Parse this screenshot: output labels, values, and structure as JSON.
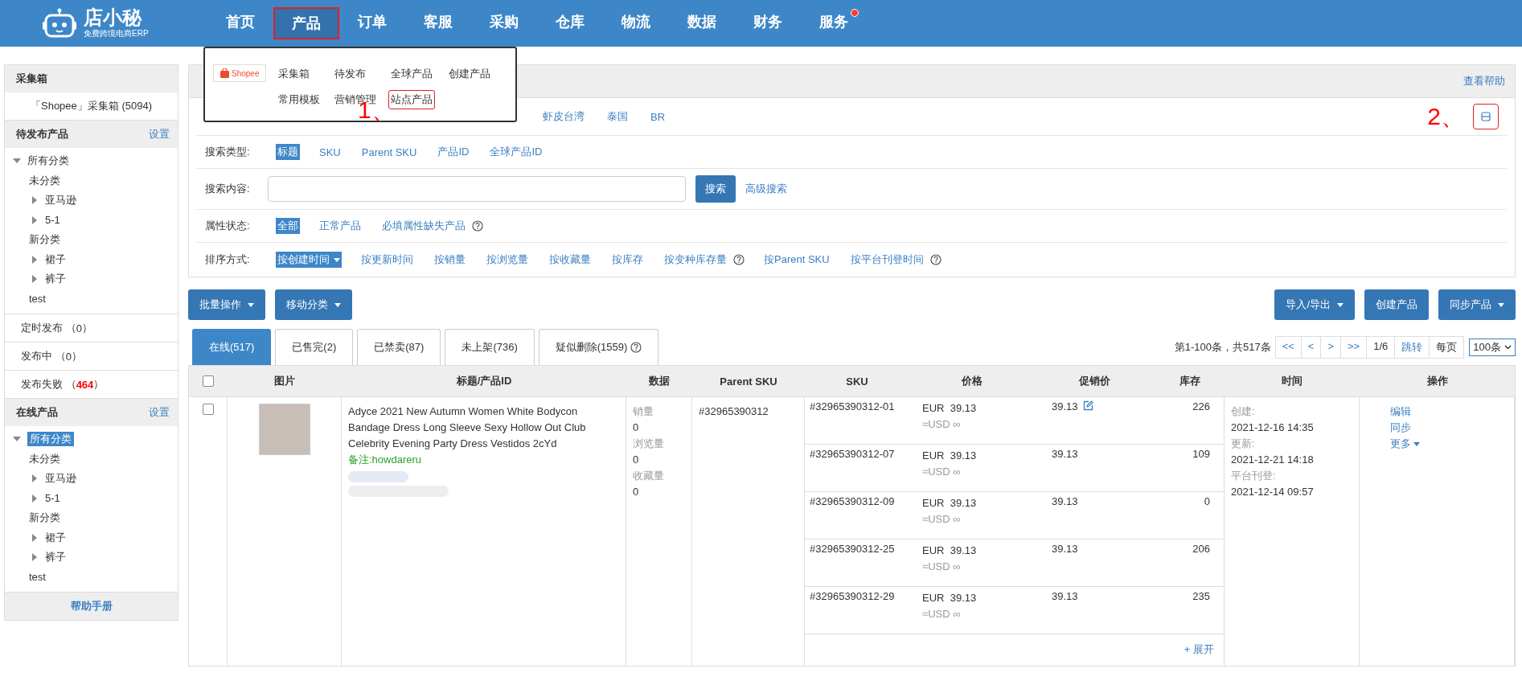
{
  "header": {
    "logo": {
      "name": "店小秘",
      "tagline": "免费跨境电商ERP"
    },
    "nav": [
      {
        "label": "首页",
        "selected": false,
        "marked": false,
        "badge": false
      },
      {
        "label": "产品",
        "selected": true,
        "marked": true,
        "badge": false
      },
      {
        "label": "订单",
        "selected": false,
        "marked": false,
        "badge": false
      },
      {
        "label": "客服",
        "selected": false,
        "marked": false,
        "badge": false
      },
      {
        "label": "采购",
        "selected": false,
        "marked": false,
        "badge": false
      },
      {
        "label": "仓库",
        "selected": false,
        "marked": false,
        "badge": false
      },
      {
        "label": "物流",
        "selected": false,
        "marked": false,
        "badge": false
      },
      {
        "label": "数据",
        "selected": false,
        "marked": false,
        "badge": false
      },
      {
        "label": "财务",
        "selected": false,
        "marked": false,
        "badge": false
      },
      {
        "label": "服务",
        "selected": false,
        "marked": false,
        "badge": true
      }
    ]
  },
  "dropdown": {
    "platform": "Shopee",
    "annotation": "1、",
    "items": [
      {
        "label": "采集箱",
        "marked": false
      },
      {
        "label": "待发布",
        "marked": false
      },
      {
        "label": "全球产品",
        "marked": false
      },
      {
        "label": "创建产品",
        "marked": false
      },
      {
        "label": "常用模板",
        "marked": false
      },
      {
        "label": "营销管理",
        "marked": false
      },
      {
        "label": "站点产品",
        "marked": true
      }
    ]
  },
  "sidebar": {
    "sections": [
      {
        "kind": "list",
        "title": "采集箱",
        "items": [
          {
            "label": "「Shopee」采集箱 (5094)"
          }
        ]
      },
      {
        "kind": "tree",
        "title": "待发布产品",
        "action": "设置",
        "tree": [
          {
            "label": "所有分类",
            "expanded": true,
            "selected": false,
            "children": [
              {
                "label": "未分类",
                "selected": false,
                "children": [
                  {
                    "label": "亚马逊",
                    "expanded": false,
                    "selected": false
                  },
                  {
                    "label": "5-1",
                    "expanded": false,
                    "selected": false
                  }
                ]
              },
              {
                "label": "新分类",
                "selected": false,
                "children": [
                  {
                    "label": "裙子",
                    "expanded": false,
                    "selected": false
                  },
                  {
                    "label": "裤子",
                    "expanded": false,
                    "selected": false
                  }
                ]
              },
              {
                "label": "test",
                "selected": false
              }
            ]
          }
        ]
      },
      {
        "kind": "status",
        "items": [
          {
            "label": "定时发布 （**0**）",
            "alert": false
          },
          {
            "label": "发布中 （**0**）",
            "alert": false
          },
          {
            "label": "发布失败 （**464**）",
            "alert": true
          }
        ]
      },
      {
        "kind": "tree",
        "title": "在线产品",
        "action": "设置",
        "tree": [
          {
            "label": "所有分类",
            "expanded": true,
            "selected": true,
            "children": [
              {
                "label": "未分类",
                "selected": false,
                "children": [
                  {
                    "label": "亚马逊",
                    "expanded": false,
                    "selected": false
                  },
                  {
                    "label": "5-1",
                    "expanded": false,
                    "selected": false
                  }
                ]
              },
              {
                "label": "新分类",
                "selected": false,
                "children": [
                  {
                    "label": "裙子",
                    "expanded": false,
                    "selected": false
                  },
                  {
                    "label": "裤子",
                    "expanded": false,
                    "selected": false
                  }
                ]
              },
              {
                "label": "test",
                "selected": false
              }
            ]
          }
        ]
      }
    ],
    "footer": "帮助手册"
  },
  "filters": {
    "help_link": "查看帮助",
    "sites": [
      "虾皮台湾",
      "泰国",
      "BR"
    ],
    "annotation": "2、",
    "toggle_marked": true,
    "rows": [
      {
        "kind": "options",
        "label": "搜索类型:",
        "options": [
          {
            "label": "标题",
            "selected": true,
            "help": false
          },
          {
            "label": "SKU",
            "selected": false,
            "help": false
          },
          {
            "label": "Parent SKU",
            "selected": false,
            "help": false
          },
          {
            "label": "产品ID",
            "selected": false,
            "help": false
          },
          {
            "label": "全球产品ID",
            "selected": false,
            "help": false
          }
        ]
      },
      {
        "kind": "search",
        "label": "搜索内容:",
        "button": "搜索",
        "link": "高级搜索"
      },
      {
        "kind": "options",
        "label": "属性状态:",
        "options": [
          {
            "label": "全部",
            "selected": true,
            "help": false
          },
          {
            "label": "正常产品",
            "selected": false,
            "help": false
          },
          {
            "label": "必填属性缺失产品",
            "selected": false,
            "help": true
          }
        ]
      },
      {
        "kind": "sort",
        "label": "排序方式:",
        "options": [
          {
            "label": "按创建时间",
            "selected": true,
            "help": false
          },
          {
            "label": "按更新时间",
            "selected": false,
            "help": false
          },
          {
            "label": "按销量",
            "selected": false,
            "help": false
          },
          {
            "label": "按浏览量",
            "selected": false,
            "help": false
          },
          {
            "label": "按收藏量",
            "selected": false,
            "help": false
          },
          {
            "label": "按库存",
            "selected": false,
            "help": false
          },
          {
            "label": "按变种库存量",
            "selected": false,
            "help": true
          },
          {
            "label": "按Parent SKU",
            "selected": false,
            "help": false
          },
          {
            "label": "按平台刊登时间",
            "selected": false,
            "help": true
          }
        ]
      }
    ]
  },
  "toolbar": {
    "left": [
      {
        "label": "批量操作",
        "dropdown": true
      },
      {
        "label": "移动分类",
        "dropdown": true
      }
    ],
    "right": [
      {
        "label": "导入/导出",
        "dropdown": true
      },
      {
        "label": "创建产品",
        "dropdown": false
      },
      {
        "label": "同步产品",
        "dropdown": true
      }
    ]
  },
  "tabs": [
    {
      "label": "在线(517)",
      "selected": true,
      "help": false
    },
    {
      "label": "已售完(2)",
      "selected": false,
      "help": false
    },
    {
      "label": "已禁卖(87)",
      "selected": false,
      "help": false
    },
    {
      "label": "未上架(736)",
      "selected": false,
      "help": false
    },
    {
      "label": "疑似删除(1559)",
      "selected": false,
      "help": true
    }
  ],
  "pagination": {
    "summary": "第1-100条，共517条",
    "buttons": [
      "<<",
      "<",
      ">",
      ">>"
    ],
    "page": "1/6",
    "jump": "跳转",
    "per_page_label": "每页",
    "per_page": "100条"
  },
  "table": {
    "select_all": false,
    "columns": [
      "图片",
      "标题/产品ID",
      "数据",
      "Parent SKU",
      "SKU",
      "价格",
      "促销价",
      "库存",
      "时间",
      "操作"
    ],
    "rows": [
      {
        "checked": false,
        "title": "Adyce 2021 New Autumn Women White Bodycon Bandage Dress Long Sleeve Sexy Hollow Out Club Celebrity Evening Party Dress Vestidos 2cYd",
        "remark": "备注:howdareru",
        "data": [
          {
            "label": "销量",
            "value": "0"
          },
          {
            "label": "浏览量",
            "value": "0"
          },
          {
            "label": "收藏量",
            "value": "0"
          }
        ],
        "parent_sku": "#32965390312",
        "variants": [
          {
            "sku": "#32965390312-01",
            "currency": "EUR",
            "price": "39.13",
            "usd": "≈USD ∞",
            "promo": "39.13",
            "editable": true,
            "stock": "226"
          },
          {
            "sku": "#32965390312-07",
            "currency": "EUR",
            "price": "39.13",
            "usd": "≈USD ∞",
            "promo": "39.13",
            "editable": false,
            "stock": "109"
          },
          {
            "sku": "#32965390312-09",
            "currency": "EUR",
            "price": "39.13",
            "usd": "≈USD ∞",
            "promo": "39.13",
            "editable": false,
            "stock": "0"
          },
          {
            "sku": "#32965390312-25",
            "currency": "EUR",
            "price": "39.13",
            "usd": "≈USD ∞",
            "promo": "39.13",
            "editable": false,
            "stock": "206"
          },
          {
            "sku": "#32965390312-29",
            "currency": "EUR",
            "price": "39.13",
            "usd": "≈USD ∞",
            "promo": "39.13",
            "editable": false,
            "stock": "235"
          }
        ],
        "expand": "+ 展开",
        "times": [
          {
            "label": "创建:",
            "value": "2021-12-16 14:35"
          },
          {
            "label": "更新:",
            "value": "2021-12-21 14:18"
          },
          {
            "label": "平台刊登:",
            "value": "2021-12-14 09:57"
          }
        ],
        "actions": [
          {
            "label": "编辑",
            "dropdown": false
          },
          {
            "label": "同步",
            "dropdown": false
          },
          {
            "label": "更多",
            "dropdown": true
          }
        ]
      }
    ]
  }
}
